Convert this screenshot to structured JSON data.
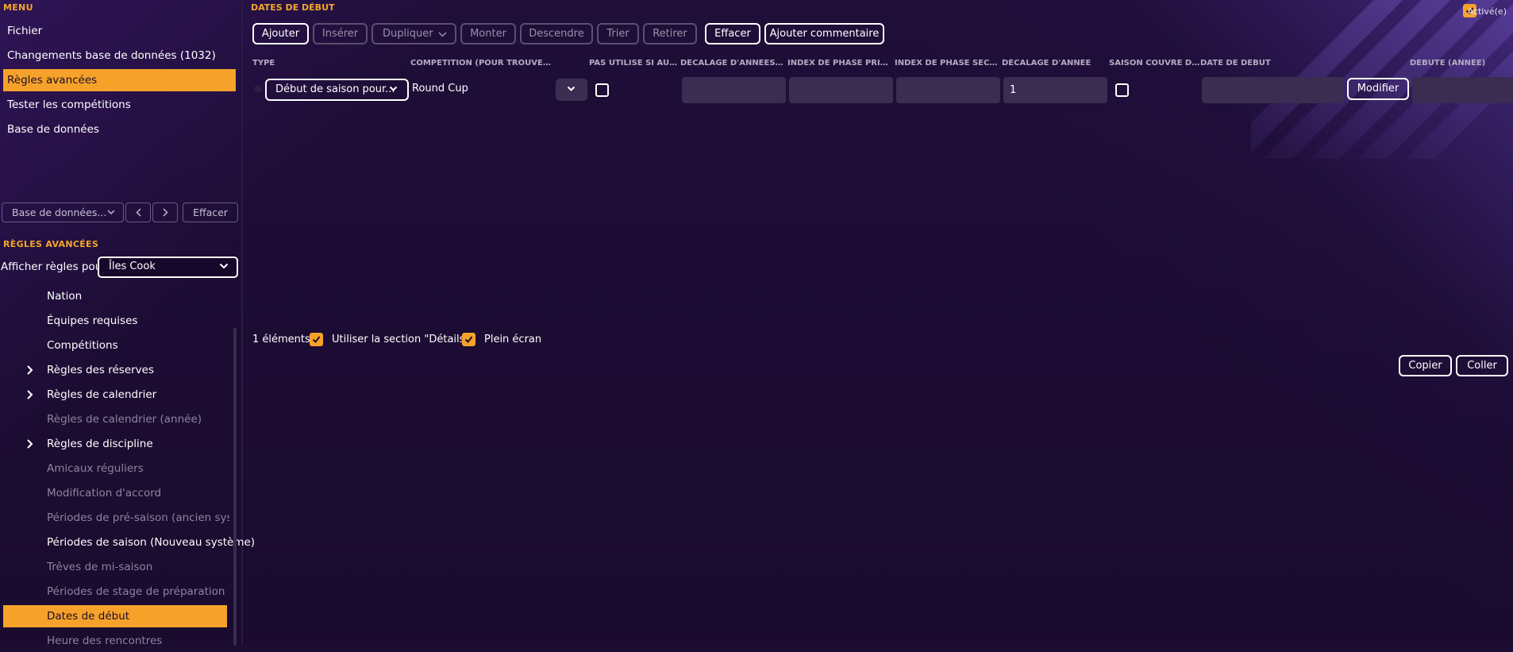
{
  "left_panel": {
    "menu_header": "MENU",
    "menu_items": [
      {
        "label": "Fichier",
        "active": false
      },
      {
        "label": "Changements base de données (1032)",
        "active": false
      },
      {
        "label": "Règles avancées",
        "active": true
      },
      {
        "label": "Tester les compétitions",
        "active": false
      },
      {
        "label": "Base de données",
        "active": false
      }
    ],
    "db_select_label": "Base de données...",
    "clear_button": "Effacer",
    "rules_header": "RÈGLES AVANCÉES",
    "show_rules_for_label": "Afficher règles pour",
    "show_rules_for_value": "Îles Cook",
    "tree_items": [
      {
        "label": "Nation",
        "dim": false,
        "arrow": false,
        "active": false
      },
      {
        "label": "Équipes requises",
        "dim": false,
        "arrow": false,
        "active": false
      },
      {
        "label": "Compétitions",
        "dim": false,
        "arrow": false,
        "active": false
      },
      {
        "label": "Règles des réserves",
        "dim": false,
        "arrow": true,
        "active": false
      },
      {
        "label": "Règles de calendrier",
        "dim": false,
        "arrow": true,
        "active": false
      },
      {
        "label": "Règles de calendrier (année)",
        "dim": true,
        "arrow": false,
        "active": false
      },
      {
        "label": "Règles de discipline",
        "dim": false,
        "arrow": true,
        "active": false
      },
      {
        "label": "Amicaux réguliers",
        "dim": true,
        "arrow": false,
        "active": false
      },
      {
        "label": "Modification d'accord",
        "dim": true,
        "arrow": false,
        "active": false
      },
      {
        "label": "Périodes de pré-saison (ancien systèm",
        "dim": true,
        "arrow": false,
        "active": false
      },
      {
        "label": "Périodes de saison (Nouveau système)",
        "dim": false,
        "arrow": false,
        "active": false
      },
      {
        "label": "Trêves de mi-saison",
        "dim": true,
        "arrow": false,
        "active": false
      },
      {
        "label": "Périodes de stage de préparation",
        "dim": true,
        "arrow": false,
        "active": false
      },
      {
        "label": "Dates de début",
        "dim": false,
        "arrow": false,
        "active": true
      },
      {
        "label": "Heure des rencontres",
        "dim": true,
        "arrow": false,
        "active": false
      }
    ]
  },
  "main": {
    "title": "DATES DE DÉBUT",
    "active_label": "Activé(e)",
    "active_checked": true,
    "toolbar": {
      "add": "Ajouter",
      "insert": "Insérer",
      "duplicate": "Dupliquer",
      "up": "Monter",
      "down": "Descendre",
      "sort": "Trier",
      "remove": "Retirer",
      "clear": "Effacer",
      "add_comment": "Ajouter commentaire"
    },
    "columns": [
      "TYPE",
      "COMPÉTITION (POUR TROUVER PREMIÈRE...",
      "PAS UTILISÉ SI AUCU...",
      "DÉCALAGE D'ANNÉES DE...",
      "INDEX DE PHASE PRINCIP...",
      "INDEX DE PHASE SECOND...",
      "DÉCALAGE D'ANNÉE",
      "SAISON COUVRE DEU...",
      "DATE DE DÉBUT",
      "DÉBUTE (ANNÉE)"
    ],
    "row": {
      "type": "Début de saison pour...",
      "competition": "Round Cup",
      "year_offset": "1",
      "modify_button": "Modifier"
    },
    "footer": {
      "count": "1 éléments",
      "use_details": "Utiliser la section \"Détails\"",
      "fullscreen": "Plein écran",
      "copy": "Copier",
      "paste": "Coller"
    },
    "colors": {
      "accent": "#f6a22a",
      "background": "#1d0d33",
      "cell": "#3b2c52"
    }
  }
}
